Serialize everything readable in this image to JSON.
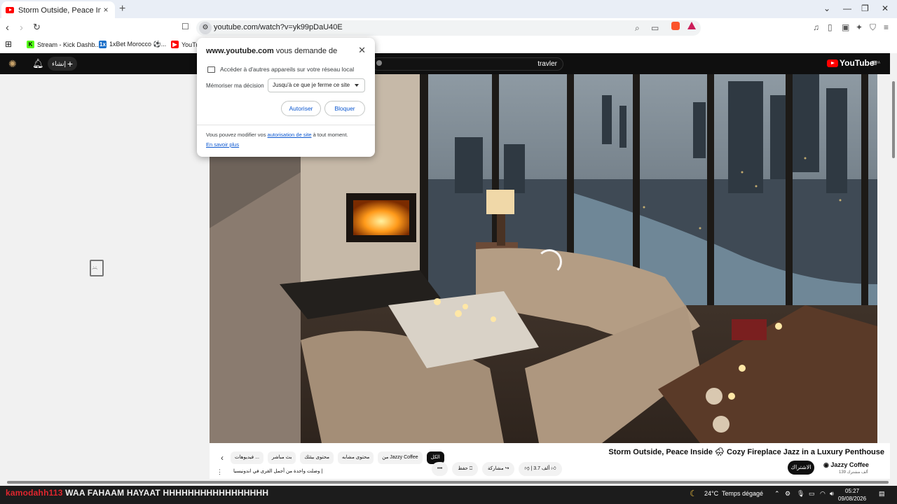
{
  "browser": {
    "tab_title": "Storm Outside, Peace Inside 🌧 ",
    "tab_close": "×",
    "new_tab": "+",
    "url": "youtube.com/watch?v=yk99pDaU40E",
    "window_controls": [
      "⌄",
      "—",
      "❐",
      "✕"
    ]
  },
  "bookmarks": [
    {
      "label": "Stream - Kick Dashb...",
      "icon": "kick-icon",
      "color": "#53fc18",
      "glyph": "K"
    },
    {
      "label": "1xBet Morocco ⚽...",
      "icon": "1xbet-icon",
      "color": "#1a6fc9",
      "glyph": "1x"
    },
    {
      "label": "YouTu",
      "icon": "youtube-icon",
      "color": "#ff0000",
      "glyph": "▶"
    }
  ],
  "youtube": {
    "create_label": "إنشاء",
    "search_query": "travler",
    "logo_text": "YouTube",
    "logo_region": "MA"
  },
  "popup": {
    "site": "www.youtube.com",
    "title_suffix": " vous demande de",
    "permission": "Accéder à d'autres appareils sur votre réseau local",
    "remember_label": "Mémoriser ma décision",
    "remember_value": "Jusqu'à ce que je ferme ce site",
    "allow_label": "Autoriser",
    "block_label": "Bloquer",
    "note_prefix": "Vous pouvez modifier vos ",
    "note_link": "autorisation de site",
    "note_suffix": " à tout moment.",
    "learn_more": "En savoir plus"
  },
  "video": {
    "title": "Storm Outside, Peace Inside 🌧 Cozy Fireplace Jazz in a Luxury Penthouse",
    "channel": "Jazzy Coffee",
    "subscribers": "139 ألف مشترك",
    "subscribe_label": "الاشتراك",
    "likes": "3.7 ألف",
    "share_label": "مشاركة",
    "save_label": "حفظ",
    "more_label": "•••",
    "description": "وصلت واحدة من أجمل القرى في اندونيسيا |"
  },
  "chips": [
    {
      "label": "الكل",
      "active": true
    },
    {
      "label": "من Jazzy Coffee",
      "active": false
    },
    {
      "label": "محتوى مشابه",
      "active": false
    },
    {
      "label": "محتوى بيئتك",
      "active": false
    },
    {
      "label": "بث مباشر",
      "active": false
    },
    {
      "label": "فيديوهات ...",
      "active": false
    }
  ],
  "taskbar": {
    "handle": "kamodahh113",
    "banner": " WAA FAHAAM HAYAAT HHHHHHHHHHHHHHHHH",
    "weather": "24°C",
    "weather_desc": "Temps dégagé",
    "time": "05:27",
    "date": "09/08/2026"
  }
}
